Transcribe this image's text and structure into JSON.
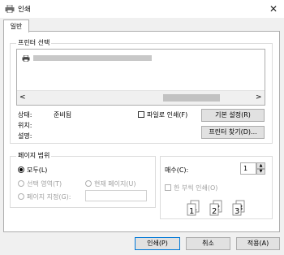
{
  "window": {
    "title": "인쇄",
    "close_glyph": "✕"
  },
  "tabs": [
    {
      "label": "일반"
    }
  ],
  "printer_select": {
    "legend": "프린터 선택",
    "scroll_left": "<",
    "scroll_right": ">"
  },
  "status": {
    "state_label": "상태:",
    "state_value": "준비됨",
    "location_label": "위치:",
    "comment_label": "설명:",
    "print_to_file_label": "파일로 인쇄(F)",
    "preferences_button": "기본 설정(R)",
    "find_printer_button": "프린터 찾기(D)..."
  },
  "page_range": {
    "legend": "페이지 범위",
    "all_label": "모두(L)",
    "selection_label": "선택 영역(T)",
    "current_page_label": "현재 페이지(U)",
    "pages_label": "페이지 지정(G):",
    "pages_value": ""
  },
  "copies": {
    "label": "매수(C):",
    "value": "1",
    "collate_label": "한 부씩 인쇄(O)",
    "spin_up": "▲",
    "spin_down": "▼"
  },
  "footer": {
    "print_button": "인쇄(P)",
    "cancel_button": "취소",
    "apply_button": "적용(A)"
  }
}
